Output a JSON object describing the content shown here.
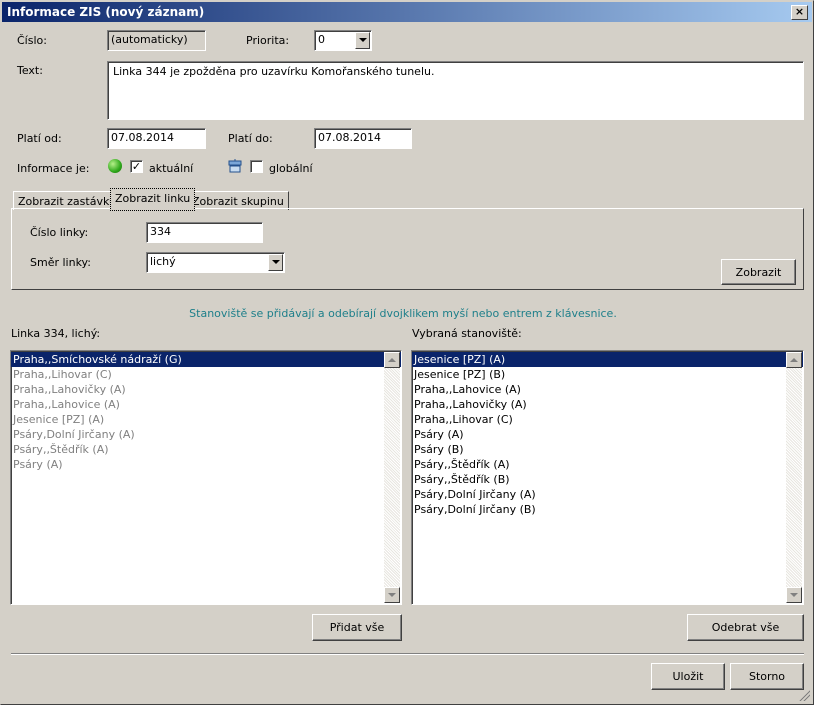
{
  "window": {
    "title": "Informace ZIS (nový záznam)",
    "close_label": "×"
  },
  "form": {
    "cislo_label": "Číslo:",
    "cislo_value": "(automaticky)",
    "priorita_label": "Priorita:",
    "priorita_value": "0",
    "text_label": "Text:",
    "text_value": "Linka 344 je zpožděna pro uzavírku Komořanského tunelu.",
    "plati_od_label": "Platí od:",
    "plati_od_value": "07.08.2014",
    "plati_do_label": "Platí do:",
    "plati_do_value": "07.08.2014",
    "informace_label": "Informace je:",
    "aktualni_label": "aktuální",
    "aktualni_checked": "✓",
    "globalni_label": "globální"
  },
  "tabs": [
    {
      "label": "Zobrazit zastávku"
    },
    {
      "label": "Zobrazit linku"
    },
    {
      "label": "Zobrazit skupinu"
    }
  ],
  "linka_panel": {
    "cislo_linky_label": "Číslo linky:",
    "cislo_linky_value": "334",
    "smer_linky_label": "Směr linky:",
    "smer_linky_value": "lichý",
    "zobrazit_label": "Zobrazit"
  },
  "hint": "Stanoviště se přidávají a odebírají dvojklikem myší nebo entrem z klávesnice.",
  "left_list": {
    "header": "Linka 334, lichý:",
    "items": [
      "Praha,,Smíchovské nádraží (G)",
      "Praha,,Lihovar (C)",
      "Praha,,Lahovičky (A)",
      "Praha,,Lahovice (A)",
      "Jesenice [PZ] (A)",
      "Psáry,Dolní Jirčany (A)",
      "Psáry,,Štědřík (A)",
      "Psáry (A)"
    ]
  },
  "right_list": {
    "header": "Vybraná stanoviště:",
    "items": [
      "Jesenice [PZ] (A)",
      "Jesenice [PZ] (B)",
      "Praha,,Lahovice (A)",
      "Praha,,Lahovičky (A)",
      "Praha,,Lihovar (C)",
      "Psáry (A)",
      "Psáry (B)",
      "Psáry,,Štědřík (A)",
      "Psáry,,Štědřík (B)",
      "Psáry,Dolní Jirčany (A)",
      "Psáry,Dolní Jirčany (B)"
    ]
  },
  "buttons": {
    "pridat_vse": "Přidat vše",
    "odebrat_vse": "Odebrat vše",
    "ulozit": "Uložit",
    "storno": "Storno"
  },
  "colors": {
    "hint": "#1e7f8a",
    "selection": "#0a246a",
    "titlebar": "#0a246a"
  }
}
